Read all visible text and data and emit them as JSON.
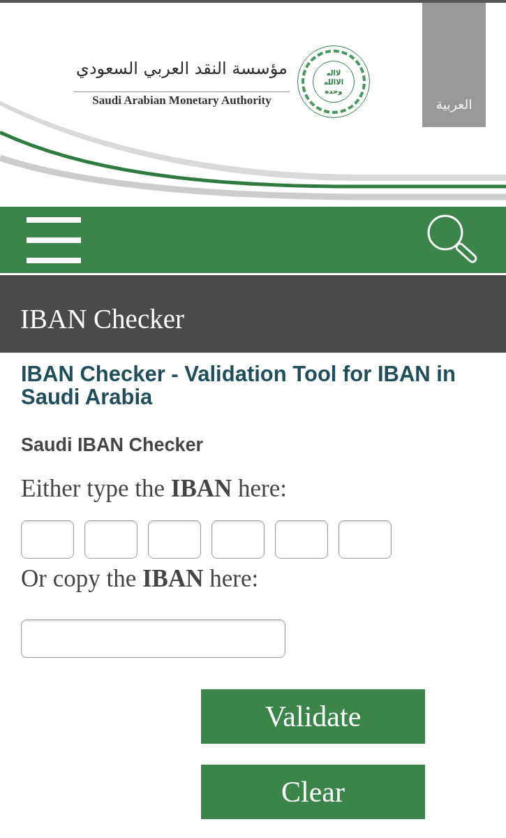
{
  "header": {
    "logo": {
      "arabic_name": "مؤسسة النقد العربي السعودي",
      "english_name": "Saudi Arabian Monetary Authority",
      "emblem_text": [
        "لااله",
        "الاالله",
        "وحده"
      ]
    },
    "language_link": "العربية"
  },
  "page_title": "IBAN Checker",
  "checker": {
    "heading": "IBAN Checker - Validation Tool for IBAN in Saudi Arabia",
    "subheading": "Saudi IBAN Checker",
    "type_label": "Either type the **IBAN** here:",
    "copy_label": "Or copy the **IBAN** here:",
    "buttons": [
      "Validate",
      "Clear"
    ]
  }
}
